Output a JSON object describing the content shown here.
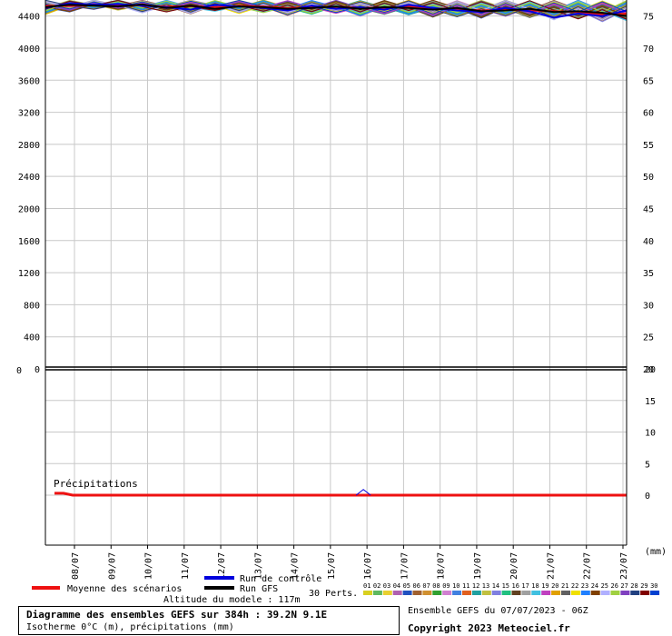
{
  "chart_data": [
    {
      "type": "line",
      "panel": "isotherm-and-temperature",
      "ylabel_left": "Isotherme 0°C (m)",
      "ylim_left": [
        0,
        4600
      ],
      "yticks_left": [
        4400,
        4000,
        3600,
        3200,
        2800,
        2400,
        2000,
        1600,
        1200,
        800,
        400,
        0
      ],
      "ylim_right": [
        20,
        77
      ],
      "yticks_right": [
        75,
        70,
        65,
        60,
        55,
        50,
        45,
        40,
        35,
        30,
        25,
        20
      ],
      "series": [
        {
          "name": "Moyenne des scénarios",
          "color": "#ee1111",
          "values": [
            4530,
            4525,
            4535,
            4540,
            4530,
            4520,
            4525,
            4510,
            4530,
            4520,
            4500,
            4510,
            4515,
            4505,
            4500,
            4520,
            4495,
            4490,
            4470,
            4480,
            4470,
            4460,
            4450,
            4420,
            4430
          ]
        },
        {
          "name": "Run de contrôle",
          "color": "#0000dd",
          "values": [
            4500,
            4560,
            4540,
            4550,
            4530,
            4510,
            4480,
            4540,
            4520,
            4500,
            4470,
            4530,
            4490,
            4510,
            4480,
            4540,
            4500,
            4470,
            4450,
            4500,
            4460,
            4380,
            4430,
            4400,
            4470
          ]
        },
        {
          "name": "Run GFS",
          "color": "#000000",
          "values": [
            4510,
            4540,
            4530,
            4520,
            4545,
            4500,
            4530,
            4490,
            4520,
            4510,
            4490,
            4500,
            4520,
            4490,
            4510,
            4500,
            4480,
            4500,
            4460,
            4470,
            4490,
            4450,
            4460,
            4440,
            4400
          ]
        }
      ],
      "perturbation_count": 30,
      "perturbation_envelope_low": [
        4420,
        4450,
        4480,
        4470,
        4440,
        4450,
        4420,
        4460,
        4430,
        4440,
        4410,
        4420,
        4430,
        4400,
        4420,
        4410,
        4380,
        4390,
        4370,
        4390,
        4380,
        4350,
        4360,
        4330,
        4340
      ],
      "perturbation_envelope_high": [
        4600,
        4600,
        4600,
        4600,
        4600,
        4600,
        4600,
        4600,
        4600,
        4600,
        4600,
        4600,
        4600,
        4600,
        4600,
        4600,
        4600,
        4600,
        4600,
        4600,
        4600,
        4600,
        4600,
        4600,
        4600
      ],
      "grid": true
    },
    {
      "type": "bar",
      "panel": "precipitation",
      "title": "Précipitations",
      "unit": "(mm)",
      "ylim": [
        -6,
        20
      ],
      "yticks": [
        20,
        15,
        10,
        5,
        0
      ],
      "mean_values": [
        0.3,
        0.3,
        0.0,
        0.0,
        0.0,
        0.0,
        0.0,
        0.0,
        0.0,
        0.0,
        0.0,
        0.0,
        0.0,
        0.0,
        0.0,
        0.0,
        0.0,
        0.0,
        0.0,
        0.0,
        0.0,
        0.0,
        0.0,
        0.0,
        0.0,
        0.0,
        0.0,
        0.0,
        0.0,
        0.0,
        0.0,
        0.0,
        0.0,
        0.0,
        0.0,
        0.0,
        0.0,
        0.0,
        0.0,
        0.0,
        0.0,
        0.0,
        0.0,
        0.0,
        0.0,
        0.0,
        0.0,
        0.0,
        0.0,
        0.0,
        0.0,
        0.0,
        0.0,
        0.0,
        0.0,
        0.0,
        0.0,
        0.0,
        0.0,
        0.0,
        0.0,
        0.0,
        0.0,
        0.0
      ],
      "control_spikes": [
        {
          "day_index": 9,
          "value": 0.9
        }
      ],
      "grid": true
    }
  ],
  "x_axis": {
    "tick_labels": [
      "08/07",
      "09/07",
      "10/07",
      "11/07",
      "12/07",
      "13/07",
      "14/07",
      "15/07",
      "16/07",
      "17/07",
      "18/07",
      "19/07",
      "20/07",
      "21/07",
      "22/07",
      "23/07"
    ]
  },
  "legend": {
    "mean_label": "Moyenne des scénarios",
    "control_label": "Run de contrôle",
    "gfs_label": "Run GFS",
    "perts_label": "30 Perts.",
    "altitude_label": "Altitude du modele : 117m",
    "pert_numbers": [
      "01",
      "02",
      "03",
      "04",
      "05",
      "06",
      "07",
      "08",
      "09",
      "10",
      "11",
      "12",
      "13",
      "14",
      "15",
      "16",
      "17",
      "18",
      "19",
      "20",
      "21",
      "22",
      "23",
      "24",
      "25",
      "26",
      "27",
      "28",
      "29",
      "30"
    ],
    "pert_colors": [
      "#d8d020",
      "#5fb85f",
      "#e8d030",
      "#b060b0",
      "#2050c0",
      "#a06030",
      "#d09030",
      "#30a030",
      "#d080d0",
      "#4080e0",
      "#e06020",
      "#20a0a0",
      "#c0c040",
      "#8080e0",
      "#20c080",
      "#604020",
      "#a0a0a0",
      "#40c0e0",
      "#c040c0",
      "#e0a000",
      "#606060",
      "#f0e000",
      "#2080ff",
      "#804000",
      "#b0b0ff",
      "#a0d040",
      "#8040c0",
      "#204080",
      "#800000",
      "#0040d0"
    ]
  },
  "footer": {
    "title": "Diagramme des ensembles GEFS sur 384h : 39.2N 9.1E",
    "subtitle": "Isotherme 0°C (m), précipitations (mm)",
    "ensemble": "Ensemble GEFS du 07/07/2023 - 06Z",
    "copyright": "Copyright 2023 Meteociel.fr"
  },
  "colors": {
    "mean": "#ee1111",
    "control": "#0000dd",
    "gfs": "#000000",
    "grid": "#c8c8c8"
  }
}
